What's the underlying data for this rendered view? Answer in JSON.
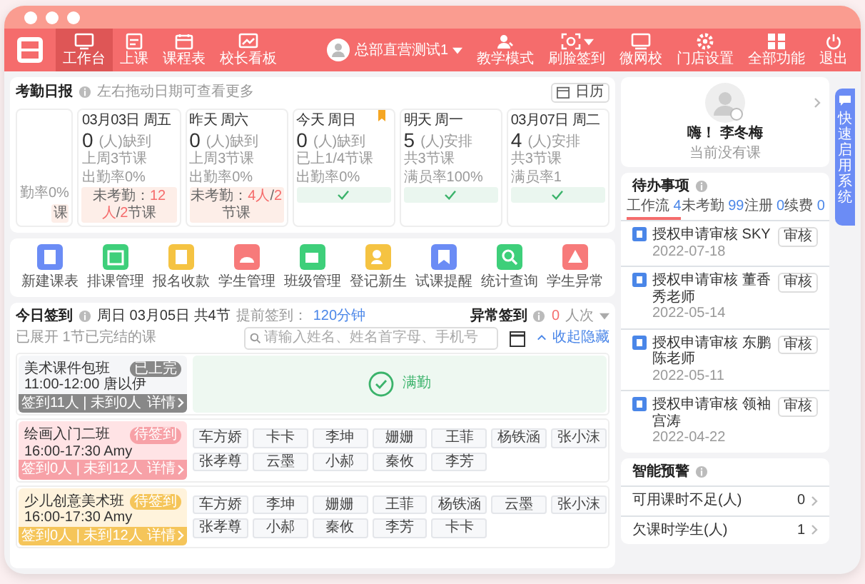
{
  "navbar": {
    "left_items": [
      {
        "label": "工作台",
        "selected": true
      },
      {
        "label": "上课",
        "selected": false
      },
      {
        "label": "课程表",
        "selected": false
      },
      {
        "label": "校长看板",
        "selected": false
      }
    ],
    "account": {
      "name": "总部直营测试1",
      "dropdown": true
    },
    "right_items": [
      {
        "label": "教学模式",
        "dropdown": false
      },
      {
        "label": "刷脸签到",
        "dropdown": true
      },
      {
        "label": "微网校",
        "dropdown": false
      },
      {
        "label": "门店设置",
        "dropdown": false
      },
      {
        "label": "全部功能",
        "dropdown": false
      },
      {
        "label": "退出",
        "dropdown": false
      }
    ]
  },
  "attendance": {
    "title": "考勤日报",
    "hint": "左右拖动日期可查看更多",
    "calendar_button": "日历",
    "days": [
      {
        "stat_right": "勤率0%",
        "flagged": false,
        "kind": "warn",
        "footer": [
          {
            "text": "课",
            "highlight": false
          }
        ]
      },
      {
        "date": "03月03日 周五",
        "count": "0",
        "unit": "(人)缺到",
        "stat_left": "上周3节课",
        "stat_right": "出勤率0%",
        "flagged": false,
        "kind": "warn",
        "footer": [
          {
            "text": "未考勤：",
            "highlight": false
          },
          {
            "text": "12人",
            "highlight": true
          },
          {
            "text": "/",
            "highlight": false
          },
          {
            "text": "2",
            "highlight": true
          },
          {
            "text": "节课",
            "highlight": false
          }
        ]
      },
      {
        "date": "昨天 周六",
        "count": "0",
        "unit": "(人)缺到",
        "stat_left": "上周3节课",
        "stat_right": "出勤率0%",
        "flagged": false,
        "kind": "warn",
        "footer": [
          {
            "text": "未考勤：",
            "highlight": false
          },
          {
            "text": "4人",
            "highlight": true
          },
          {
            "text": "/",
            "highlight": false
          },
          {
            "text": "2",
            "highlight": true
          },
          {
            "text": "节课",
            "highlight": false
          }
        ]
      },
      {
        "date": "今天 周日",
        "count": "0",
        "unit": "(人)缺到",
        "stat_left": "已上1/4节课",
        "stat_right": "出勤率0%",
        "flagged": true,
        "kind": "ok"
      },
      {
        "date": "明天 周一",
        "count": "5",
        "unit": "(人)安排",
        "stat_left": "共3节课",
        "stat_right": "满员率100%",
        "flagged": false,
        "kind": "ok"
      },
      {
        "date": "03月07日 周二",
        "count": "4",
        "unit": "(人)安排",
        "stat_left": "共3节课",
        "stat_right": "满员率1",
        "flagged": false,
        "kind": "ok"
      }
    ]
  },
  "quick_actions": [
    {
      "label": "新建课表",
      "color": "#6b8cf5"
    },
    {
      "label": "排课管理",
      "color": "#3ecf7a"
    },
    {
      "label": "报名收款",
      "color": "#f5c342"
    },
    {
      "label": "学生管理",
      "color": "#f77a7a"
    },
    {
      "label": "班级管理",
      "color": "#3ecf7a"
    },
    {
      "label": "登记新生",
      "color": "#f5c342"
    },
    {
      "label": "试课提醒",
      "color": "#6b8cf5"
    },
    {
      "label": "统计查询",
      "color": "#3ecf7a"
    },
    {
      "label": "学生异常",
      "color": "#f77a7a"
    }
  ],
  "sign_in": {
    "title": "今日签到",
    "date": "周日 03月05日 共4节",
    "advance_label": "提前签到：",
    "advance_value": "120分钟",
    "search_placeholder": "请输入姓名、姓名首字母、手机号",
    "summary": "已展开 1节已完结的课",
    "collapse": "收起隐藏",
    "abnormal": {
      "title": "异常签到",
      "count": "0",
      "unit": "人次"
    },
    "classes": [
      {
        "kind": "done",
        "name": "美术课件包班",
        "time": "11:00-12:00 唐以伊",
        "status": "已上完",
        "footer": "签到11人 | 未到0人",
        "detail": "详情",
        "message": "满勤"
      },
      {
        "kind": "alert",
        "name": "绘画入门二班",
        "time": "16:00-17:30 Amy",
        "status": "待签到",
        "footer": "签到0人 | 未到12人",
        "detail": "详情",
        "students": [
          "车方娇",
          "卡卡",
          "李坤",
          "姗姗",
          "王菲",
          "杨铁涵",
          "张小沫",
          "张孝尊",
          "云墨",
          "小郝",
          "秦攸",
          "李芳"
        ]
      },
      {
        "kind": "upcoming",
        "name": "少儿创意美术班",
        "time": "16:00-17:30 Amy",
        "status": "待签到",
        "footer": "签到0人 | 未到12人",
        "detail": "详情",
        "students": [
          "车方娇",
          "李坤",
          "姗姗",
          "王菲",
          "杨铁涵",
          "云墨",
          "张小沫",
          "张孝尊",
          "小郝",
          "秦攸",
          "李芳",
          "卡卡"
        ]
      }
    ]
  },
  "profile": {
    "greeting": "嗨！ 李冬梅",
    "status": "当前没有课"
  },
  "side_tab": {
    "label": "快速启用系统"
  },
  "todo": {
    "title": "待办事项",
    "tabs": [
      {
        "label": "工作流",
        "count": "4",
        "selected": true
      },
      {
        "label": "未考勤",
        "count": "99",
        "selected": false
      },
      {
        "label": "注册",
        "count": "0",
        "selected": false
      },
      {
        "label": "续费",
        "count": "0",
        "selected": false
      }
    ],
    "items": [
      {
        "title": "授权申请审核 SKY",
        "date": "2022-07-18",
        "action": "审核"
      },
      {
        "title": "授权申请审核 董香秀老师",
        "date": "2022-05-14",
        "action": "审核"
      },
      {
        "title": "授权申请审核 东鹏陈老师",
        "date": "2022-05-11",
        "action": "审核"
      },
      {
        "title": "授权申请审核 领袖宫涛",
        "date": "2022-04-22",
        "action": "审核"
      }
    ]
  },
  "warnings": {
    "title": "智能预警",
    "rows": [
      {
        "label": "可用课时不足(人)",
        "value": "0"
      },
      {
        "label": "欠课时学生(人)",
        "value": "1"
      }
    ]
  }
}
